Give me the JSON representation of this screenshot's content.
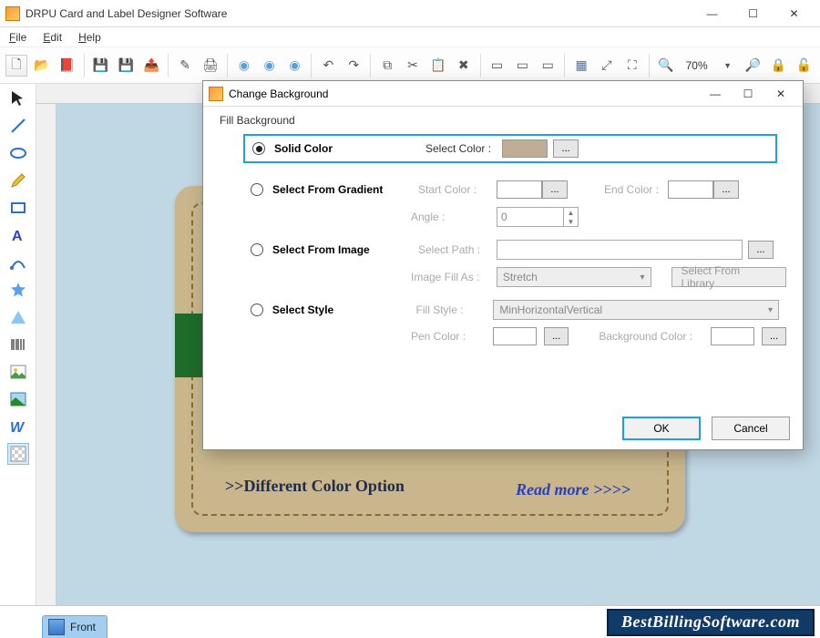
{
  "app": {
    "title": "DRPU Card and Label Designer Software"
  },
  "menu": {
    "file": "File",
    "edit": "Edit",
    "help": "Help"
  },
  "zoom": "70%",
  "tab": {
    "front": "Front"
  },
  "card": {
    "text1": ">>Different Color Option",
    "link": "Read more >>>>"
  },
  "dialog": {
    "title": "Change Background",
    "section": "Fill Background",
    "solid": {
      "label": "Solid Color",
      "select_color": "Select Color :",
      "browse": "..."
    },
    "gradient": {
      "label": "Select From Gradient",
      "start": "Start Color :",
      "end": "End Color :",
      "angle": "Angle :",
      "angle_val": "0",
      "browse": "..."
    },
    "image": {
      "label": "Select From Image",
      "path": "Select Path :",
      "fillas": "Image Fill As :",
      "fillas_val": "Stretch",
      "lib": "Select From Library",
      "browse": "..."
    },
    "style": {
      "label": "Select Style",
      "fillstyle": "Fill Style :",
      "fillstyle_val": "MinHorizontalVertical",
      "pen": "Pen Color :",
      "bg": "Background Color :",
      "browse": "..."
    },
    "ok": "OK",
    "cancel": "Cancel"
  },
  "brand": "BestBillingSoftware.com"
}
